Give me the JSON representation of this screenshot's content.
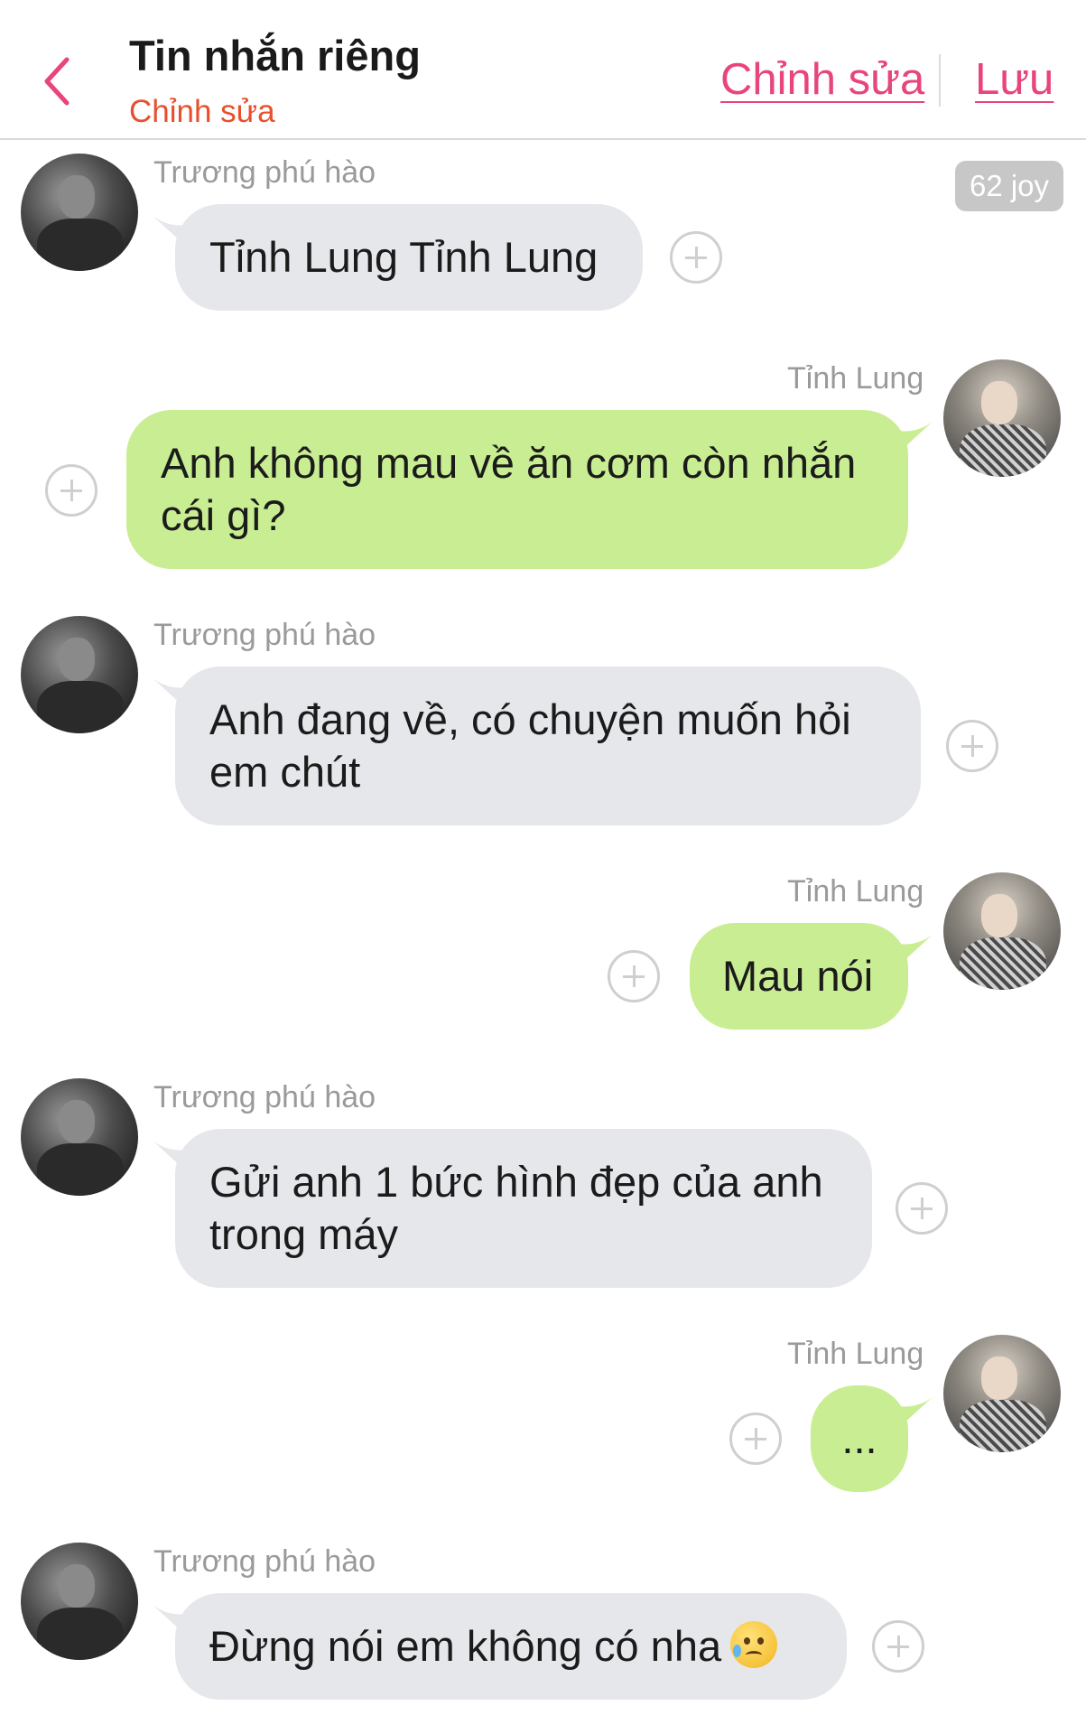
{
  "header": {
    "title": "Tin nhắn riêng",
    "subtitle": "Chỉnh sửa",
    "edit_label": "Chỉnh sửa",
    "save_label": "Lưu",
    "accent_color": "#e8457a",
    "back_icon": "chevron-left-icon"
  },
  "badge": {
    "label": "62 joy"
  },
  "messages": [
    {
      "sender": "Trương phú hào",
      "side": "left",
      "text": "Tỉnh Lung Tỉnh Lung"
    },
    {
      "sender": "Tỉnh Lung",
      "side": "right",
      "text": "Anh không mau về ăn cơm còn nhắn cái gì?"
    },
    {
      "sender": "Trương phú hào",
      "side": "left",
      "text": "Anh đang về, có chuyện muốn hỏi em chút"
    },
    {
      "sender": "Tỉnh Lung",
      "side": "right",
      "text": "Mau nói"
    },
    {
      "sender": "Trương phú hào",
      "side": "left",
      "text": "Gửi anh 1 bức hình đẹp của anh trong máy"
    },
    {
      "sender": "Tỉnh Lung",
      "side": "right",
      "text": "..."
    },
    {
      "sender": "Trương phú hào",
      "side": "left",
      "text": "Đừng nói em không có nha",
      "emoji": "crying-smile-emoji"
    }
  ],
  "colors": {
    "left_bubble": "#e6e7eb",
    "right_bubble": "#c9ed92",
    "sender_name": "#9a9a9a"
  }
}
